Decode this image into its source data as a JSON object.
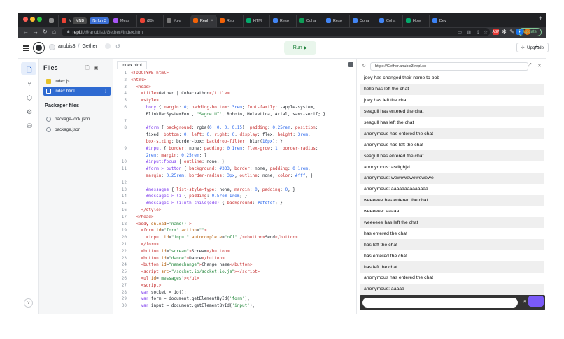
{
  "browser": {
    "tabs": [
      {
        "label": "",
        "fav": "#8b8b8b"
      },
      {
        "label": "M",
        "fav": "#ea4335"
      },
      {
        "label": "MNB",
        "pill": "#4a4a4a"
      },
      {
        "label": "Nr fun 3",
        "pill": "#3b6fd4"
      },
      {
        "label": "Mess",
        "fav": "#a855f7"
      },
      {
        "label": "(29)",
        "fav": "#ea4335"
      },
      {
        "label": "#q-a",
        "fav": "#7a7a7a"
      },
      {
        "label": "Repl",
        "fav": "#f26207",
        "active": true
      },
      {
        "label": "Repl",
        "fav": "#f26207"
      },
      {
        "label": "HTM",
        "fav": "#04aa6d"
      },
      {
        "label": "Reso",
        "fav": "#4285f4"
      },
      {
        "label": "Coha",
        "fav": "#0f9d58"
      },
      {
        "label": "Reso",
        "fav": "#4285f4"
      },
      {
        "label": "Coha",
        "fav": "#4285f4"
      },
      {
        "label": "Coha",
        "fav": "#4285f4"
      },
      {
        "label": "How",
        "fav": "#04aa6d"
      },
      {
        "label": "Dev",
        "fav": "#3b82f6"
      }
    ],
    "new_tab": "+",
    "url_domain": "repl.it",
    "url_path": "/@anubis3/Gether#index.html",
    "update_label": "Update"
  },
  "header": {
    "user": "anubis3",
    "separator": "/",
    "repl_name": "Gether",
    "run_label": "Run",
    "upgrade_label": "Upgrade",
    "plus": "+"
  },
  "files": {
    "title": "Files",
    "items": [
      {
        "name": "index.js",
        "color": "#e6c229"
      },
      {
        "name": "index.html",
        "color": "#ffffff"
      }
    ],
    "packager_title": "Packager files",
    "packager_items": [
      "package-lock.json",
      "package.json"
    ],
    "help": "?"
  },
  "editor": {
    "tab_label": "index.html",
    "lines": [
      {
        "n": "1",
        "html": "<span class='tg'>&lt;!DOCTYPE html&gt;</span>"
      },
      {
        "n": "2",
        "html": "<span class='tg'>&lt;html&gt;</span>"
      },
      {
        "n": "3",
        "html": "  <span class='tg'>&lt;head&gt;</span>"
      },
      {
        "n": "4",
        "html": "    <span class='tg'>&lt;title&gt;</span>Gether | Cohackathon<span class='tg'>&lt;/title&gt;</span>"
      },
      {
        "n": "5",
        "html": "    <span class='tg'>&lt;style&gt;</span>"
      },
      {
        "n": "6",
        "html": "      <span class='kw'>body</span> { <span class='pr'>margin</span>: <span class='vl'>0</span>; <span class='pr'>padding-bottom</span>: <span class='vl'>3rem</span>; <span class='pr'>font-family</span>: -apple-system,"
      },
      {
        "n": "",
        "html": "      BlinkMacSystemFont, <span class='st'>\"Segoe UI\"</span>, Roboto, Helvetica, Arial, sans-serif; }"
      },
      {
        "n": "7",
        "html": ""
      },
      {
        "n": "8",
        "html": "      <span class='kw'>#form</span> { <span class='pr'>background</span>: rgba(<span class='vl'>0, 0, 0, 0.15</span>); <span class='pr'>padding</span>: <span class='vl'>0.25rem</span>; <span class='pr'>position</span>:"
      },
      {
        "n": "",
        "html": "      fixed; <span class='pr'>bottom</span>: <span class='vl'>0</span>; <span class='pr'>left</span>: <span class='vl'>0</span>; <span class='pr'>right</span>: <span class='vl'>0</span>; <span class='pr'>display</span>: flex; <span class='pr'>height</span>: <span class='vl'>3rem</span>;"
      },
      {
        "n": "",
        "html": "      <span class='pr'>box-sizing</span>: border-box; <span class='pr'>backdrop-filter</span>: blur(<span class='vl'>10px</span>); }"
      },
      {
        "n": "9",
        "html": "      <span class='kw'>#input</span> { <span class='pr'>border</span>: none; <span class='pr'>padding</span>: <span class='vl'>0 1rem</span>; <span class='pr'>flex-grow</span>: <span class='vl'>1</span>; <span class='pr'>border-radius</span>:"
      },
      {
        "n": "",
        "html": "      <span class='vl'>2rem</span>; <span class='pr'>margin</span>: <span class='vl'>0.25rem</span>; }"
      },
      {
        "n": "10",
        "html": "      <span class='kw'>#input:focus</span> { <span class='pr'>outline</span>: none; }"
      },
      {
        "n": "11",
        "html": "      <span class='kw'>#form &gt; button</span> { <span class='pr'>background</span>: <span class='vl'>#333</span>; <span class='pr'>border</span>: none; <span class='pr'>padding</span>: <span class='vl'>0 1rem</span>;"
      },
      {
        "n": "",
        "html": "      <span class='pr'>margin</span>: <span class='vl'>0.25rem</span>; <span class='pr'>border-radius</span>: <span class='vl'>3px</span>; <span class='pr'>outline</span>: none; <span class='pr'>color</span>: <span class='vl'>#fff</span>; }"
      },
      {
        "n": "12",
        "html": ""
      },
      {
        "n": "13",
        "html": "      <span class='kw'>#messages</span> { <span class='pr'>list-style-type</span>: none; <span class='pr'>margin</span>: <span class='vl'>0</span>; <span class='pr'>padding</span>: <span class='vl'>0</span>; }"
      },
      {
        "n": "14",
        "html": "      <span class='kw'>#messages &gt; li</span> { <span class='pr'>padding</span>: <span class='vl'>0.5rem 1rem</span>; }"
      },
      {
        "n": "15",
        "html": "      <span class='kw'>#messages &gt; li:nth-child(odd)</span> { <span class='pr'>background</span>: <span class='vl'>#efefef</span>; }"
      },
      {
        "n": "16",
        "html": "    <span class='tg'>&lt;/style&gt;</span>"
      },
      {
        "n": "17",
        "html": "  <span class='tg'>&lt;/head&gt;</span>"
      },
      {
        "n": "18",
        "html": "  <span class='tg'>&lt;body</span> <span class='at'>onload</span>=<span class='st'>'name()'</span><span class='tg'>&gt;</span>"
      },
      {
        "n": "19",
        "html": "    <span class='tg'>&lt;form</span> <span class='at'>id</span>=<span class='st'>\"form\"</span> <span class='at'>action</span>=<span class='st'>\"\"</span><span class='tg'>&gt;</span>"
      },
      {
        "n": "20",
        "html": "      <span class='tg'>&lt;input</span> <span class='at'>id</span>=<span class='st'>\"input\"</span> <span class='at'>autocomplete</span>=<span class='st'>\"off\"</span> <span class='tg'>/&gt;&lt;button&gt;</span>Send<span class='tg'>&lt;/button&gt;</span>"
      },
      {
        "n": "21",
        "html": "    <span class='tg'>&lt;/form&gt;</span>"
      },
      {
        "n": "22",
        "html": "    <span class='tg'>&lt;button</span> <span class='at'>id</span>=<span class='st'>\"scream\"</span><span class='tg'>&gt;</span>Scream<span class='tg'>&lt;/button&gt;</span>"
      },
      {
        "n": "23",
        "html": "    <span class='tg'>&lt;button</span> <span class='at'>id</span>=<span class='st'>\"dance\"</span><span class='tg'>&gt;</span>Dance<span class='tg'>&lt;/button&gt;</span>"
      },
      {
        "n": "24",
        "html": "    <span class='tg'>&lt;button</span> <span class='at'>id</span>=<span class='st'>\"namechange\"</span><span class='tg'>&gt;</span>Change name<span class='tg'>&lt;/button&gt;</span>"
      },
      {
        "n": "25",
        "html": "    <span class='tg'>&lt;script</span> <span class='at'>src</span>=<span class='st'>\"/socket.io/socket.io.js\"</span><span class='tg'>&gt;&lt;/script&gt;</span>"
      },
      {
        "n": "26",
        "html": "    <span class='tg'>&lt;ul</span> <span class='at'>id</span>=<span class='st'>'messages'</span><span class='tg'>&gt;&lt;/ul&gt;</span>"
      },
      {
        "n": "27",
        "html": "    <span class='tg'>&lt;script&gt;</span>"
      },
      {
        "n": "28",
        "html": "    <span class='kw'>var</span> socket = io();"
      },
      {
        "n": "29",
        "html": "    <span class='kw'>var</span> form = document.getElementById(<span class='st'>'form'</span>);"
      },
      {
        "n": "30",
        "html": "    <span class='kw'>var</span> input = document.getElementById(<span class='st'>'input'</span>);"
      }
    ]
  },
  "preview": {
    "url": "https://Gether.anubis3.repl.co",
    "messages": [
      "joey has changed their name to bob",
      "hello has left the chat",
      "joey has left the chat",
      "seagull has entered the chat",
      "seagull has left the chat",
      "anonymous has entered the chat",
      "anonymous has left the chat",
      "seagull has entered the chat",
      "anonymous: asdfghjkl",
      "anonymous: wewewewewewewe",
      "anonymous: aaaaaaaaaaaaaa",
      "weeeeee has entered the chat",
      "weeeeee: aaaaa",
      "weeeeee has left the chat",
      "has entered the chat",
      "has left the chat",
      "has entered the chat",
      "has left the chat",
      "anonymous has entered the chat",
      "anonymous: aaaaa"
    ],
    "send_label": "S"
  }
}
